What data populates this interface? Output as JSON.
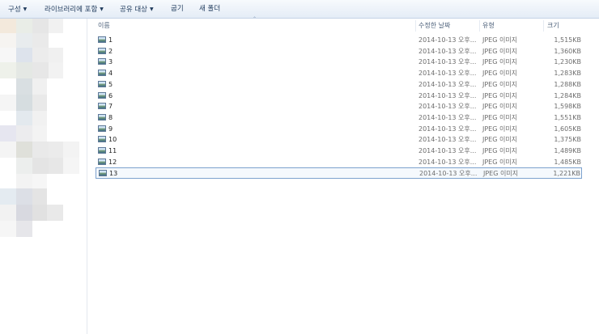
{
  "toolbar": {
    "organize": "구성",
    "include_in_library": "라이브러리에 포함",
    "share_with": "공유 대상",
    "burn": "굽기",
    "new_folder": "새 폴더"
  },
  "columns": {
    "name": "이름",
    "date_modified": "수정한 날짜",
    "type": "유형",
    "size": "크기"
  },
  "files": [
    {
      "name": "1",
      "date": "2014-10-13 오후...",
      "type": "JPEG 이미지",
      "size": "1,515KB"
    },
    {
      "name": "2",
      "date": "2014-10-13 오후...",
      "type": "JPEG 이미지",
      "size": "1,360KB"
    },
    {
      "name": "3",
      "date": "2014-10-13 오후...",
      "type": "JPEG 이미지",
      "size": "1,230KB"
    },
    {
      "name": "4",
      "date": "2014-10-13 오후...",
      "type": "JPEG 이미지",
      "size": "1,283KB"
    },
    {
      "name": "5",
      "date": "2014-10-13 오후...",
      "type": "JPEG 이미지",
      "size": "1,288KB"
    },
    {
      "name": "6",
      "date": "2014-10-13 오후...",
      "type": "JPEG 이미지",
      "size": "1,284KB"
    },
    {
      "name": "7",
      "date": "2014-10-13 오후...",
      "type": "JPEG 이미지",
      "size": "1,598KB"
    },
    {
      "name": "8",
      "date": "2014-10-13 오후...",
      "type": "JPEG 이미지",
      "size": "1,551KB"
    },
    {
      "name": "9",
      "date": "2014-10-13 오후...",
      "type": "JPEG 이미지",
      "size": "1,605KB"
    },
    {
      "name": "10",
      "date": "2014-10-13 오후...",
      "type": "JPEG 이미지",
      "size": "1,375KB"
    },
    {
      "name": "11",
      "date": "2014-10-13 오후...",
      "type": "JPEG 이미지",
      "size": "1,489KB"
    },
    {
      "name": "12",
      "date": "2014-10-13 오후...",
      "type": "JPEG 이미지",
      "size": "1,485KB"
    },
    {
      "name": "13",
      "date": "2014-10-13 오후...",
      "type": "JPEG 이미지",
      "size": "1,221KB"
    }
  ],
  "selected_file": "13",
  "colors": {
    "toolbar_text": "#1e395b",
    "selection_border": "#7da2ce",
    "selection_fill": "#f5f9fd"
  }
}
